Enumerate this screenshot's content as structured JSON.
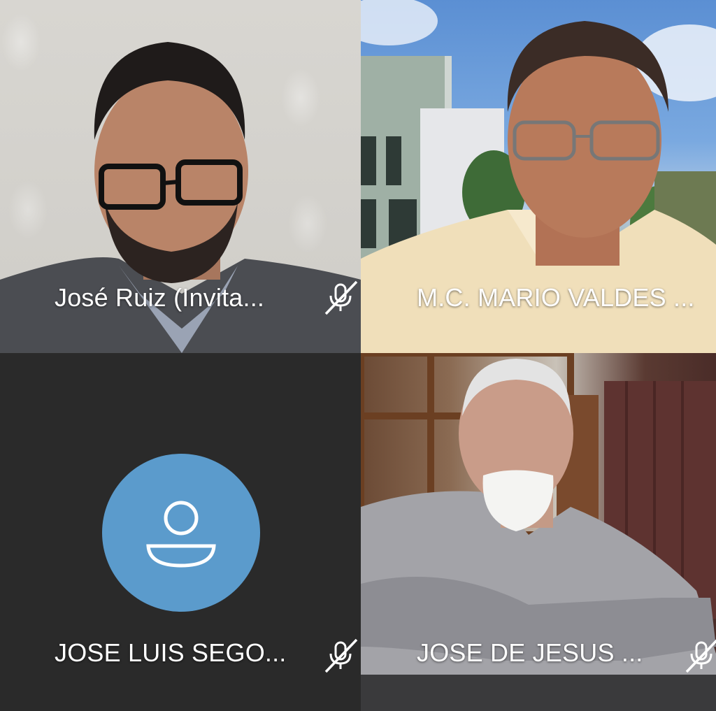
{
  "participants": [
    {
      "name": "José Ruiz (Invita...",
      "mic": "mic-muted-icon",
      "video": true
    },
    {
      "name": "M.C. MARIO VALDES ...",
      "mic": "mic-muted-icon",
      "video": true
    },
    {
      "name": "JOSE LUIS SEGO...",
      "mic": "mic-muted-icon",
      "video": false,
      "avatar": "user-avatar-icon"
    },
    {
      "name": "JOSE DE JESUS ...",
      "mic": "mic-muted-icon",
      "video": true
    }
  ],
  "colors": {
    "avatar_bg": "#5b9bcc",
    "empty_tile_bg": "#2a2a2a",
    "label_text": "#ffffff"
  }
}
